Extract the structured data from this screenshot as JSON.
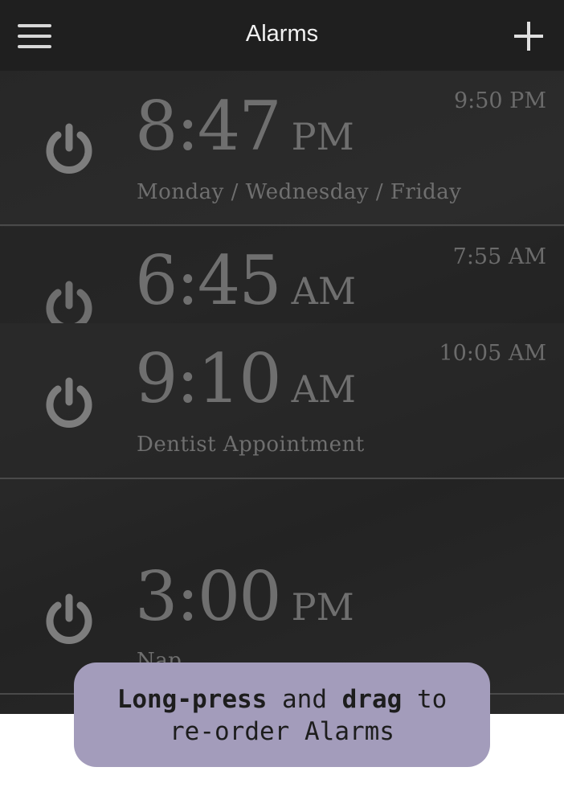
{
  "header": {
    "title": "Alarms",
    "menu_icon": "hamburger-menu-icon",
    "add_icon": "plus-icon"
  },
  "alarms": [
    {
      "time": "8:47",
      "ampm": "PM",
      "end_time": "9:50 PM",
      "label": "Monday / Wednesday / Friday",
      "icon": "power-icon"
    },
    {
      "time": "6:45",
      "ampm": "AM",
      "end_time": "7:55 AM",
      "label": "",
      "icon": "power-icon"
    },
    {
      "time": "9:10",
      "ampm": "AM",
      "end_time": "10:05 AM",
      "label": "Dentist Appointment",
      "icon": "power-icon"
    },
    {
      "time": "3:00",
      "ampm": "PM",
      "end_time": "",
      "label": "Nap",
      "icon": "power-icon"
    }
  ],
  "tooltip": {
    "bold1": "Long-press",
    "text1": " and ",
    "bold2": "drag",
    "text2": " to",
    "line2": "re-order Alarms"
  },
  "colors": {
    "background": "#2a2a2a",
    "text_dim": "#6f6f6f",
    "tooltip_bg": "#a39cbb"
  }
}
